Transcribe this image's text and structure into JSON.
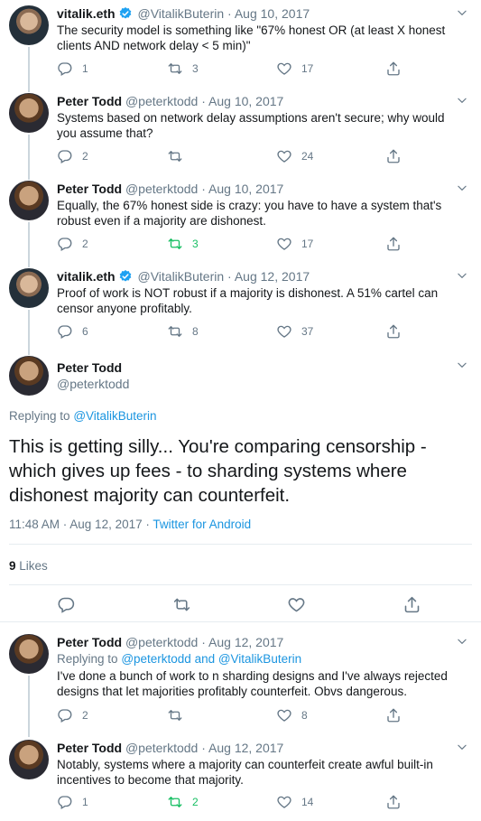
{
  "colors": {
    "accent": "#1b95e0",
    "retweet_active": "#17bf63",
    "muted": "#657786",
    "text": "#14171a",
    "border": "#e6ecf0"
  },
  "tweets": [
    {
      "name": "vitalik.eth",
      "verified": true,
      "handle": "@VitalikButerin",
      "dot": "·",
      "date": "Aug 10, 2017",
      "text": "The security model is something like \"67% honest OR (at least X honest clients AND network delay < 5 min)\"",
      "reply_count": "1",
      "retweet_count": "3",
      "like_count": "17",
      "retweeted": false
    },
    {
      "name": "Peter Todd",
      "verified": false,
      "handle": "@peterktodd",
      "dot": "·",
      "date": "Aug 10, 2017",
      "text": "Systems based on network delay assumptions aren't secure; why would you assume that?",
      "reply_count": "2",
      "retweet_count": "",
      "like_count": "24",
      "retweeted": false
    },
    {
      "name": "Peter Todd",
      "verified": false,
      "handle": "@peterktodd",
      "dot": "·",
      "date": "Aug 10, 2017",
      "text": "Equally, the 67% honest side is crazy: you have to have a system that's robust even if a majority are dishonest.",
      "reply_count": "2",
      "retweet_count": "3",
      "like_count": "17",
      "retweeted": true
    },
    {
      "name": "vitalik.eth",
      "verified": true,
      "handle": "@VitalikButerin",
      "dot": "·",
      "date": "Aug 12, 2017",
      "text": "Proof of work is NOT robust if a majority is dishonest. A 51% cartel can censor anyone profitably.",
      "reply_count": "6",
      "retweet_count": "8",
      "like_count": "37",
      "retweeted": false
    }
  ],
  "focused": {
    "name": "Peter Todd",
    "handle": "@peterktodd",
    "replying_prefix": "Replying to",
    "replying_to": "@VitalikButerin",
    "text": "This is getting silly... You're comparing censorship - which gives up fees - to sharding systems where dishonest majority can counterfeit.",
    "time_date": "11:48 AM · Aug 12, 2017 ·",
    "source": "Twitter for Android",
    "likes_count": "9",
    "likes_label": "Likes"
  },
  "replies": [
    {
      "name": "Peter Todd",
      "handle": "@peterktodd",
      "dot": "·",
      "date": "Aug 12, 2017",
      "replying_prefix": "Replying to",
      "replying_to": "@peterktodd and @VitalikButerin",
      "text": "I've done a bunch of work to n sharding designs and I've always rejected designs that let majorities profitably counterfeit. Obvs dangerous.",
      "reply_count": "2",
      "retweet_count": "",
      "like_count": "8",
      "retweeted": false
    },
    {
      "name": "Peter Todd",
      "handle": "@peterktodd",
      "dot": "·",
      "date": "Aug 12, 2017",
      "text": "Notably, systems where a majority can counterfeit create awful built-in incentives to become that majority.",
      "reply_count": "1",
      "retweet_count": "2",
      "like_count": "14",
      "retweeted": true
    }
  ]
}
